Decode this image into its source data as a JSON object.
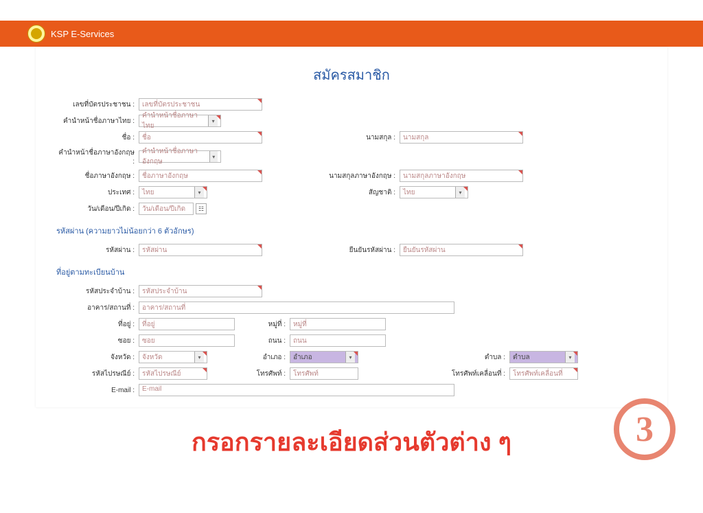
{
  "brand": "KSP E-Services",
  "page_title": "สมัครสมาชิก",
  "step_number": "3",
  "instruction_text": "กรอกรายละเอียดส่วนตัวต่าง ๆ",
  "labels": {
    "id_card": "เลขที่บัตรประชาชน :",
    "title_th": "คำนำหน้าชื่อภาษาไทย :",
    "name_th": "ชื่อ :",
    "surname_th": "นามสกุล :",
    "title_en": "คำนำหน้าชื่อภาษาอังกฤษ :",
    "name_en": "ชื่อภาษาอังกฤษ :",
    "surname_en": "นามสกุลภาษาอังกฤษ :",
    "country": "ประเทศ :",
    "nationality": "สัญชาติ :",
    "birthdate": "วัน/เดือน/ปีเกิด :",
    "password": "รหัสผ่าน :",
    "confirm_password": "ยืนยันรหัสผ่าน :",
    "house_code": "รหัสประจำบ้าน :",
    "address": "อาคาร/สถานที่ :",
    "at": "ที่อยู่ :",
    "moo": "หมู่ที่ :",
    "soi": "ซอย :",
    "road": "ถนน :",
    "province": "จังหวัด :",
    "district": "อำเภอ :",
    "subdistrict": "ตำบล :",
    "postcode": "รหัสไปรษณีย์ :",
    "phone": "โทรศัพท์ :",
    "mobile": "โทรศัพท์เคลื่อนที่ :",
    "email": "E-mail :"
  },
  "placeholders": {
    "id_card": "เลขที่บัตรประชาชน",
    "title_th": "คำนำหน้าชื่อภาษาไทย",
    "name_th": "ชื่อ",
    "surname_th": "นามสกุล",
    "title_en": "คำนำหน้าชื่อภาษาอังกฤษ",
    "name_en": "ชื่อภาษาอังกฤษ",
    "surname_en": "นามสกุลภาษาอังกฤษ",
    "country": "ไทย",
    "nationality": "ไทย",
    "birthdate": "วัน/เดือน/ปีเกิด",
    "password": "รหัสผ่าน",
    "confirm_password": "ยืนยันรหัสผ่าน",
    "house_code": "รหัสประจำบ้าน",
    "address": "อาคาร/สถานที่",
    "at": "ที่อยู่",
    "moo": "หมู่ที่",
    "soi": "ซอย",
    "road": "ถนน",
    "province": "จังหวัด",
    "district": "อำเภอ",
    "subdistrict": "ตำบล",
    "postcode": "รหัสไปรษณีย์",
    "phone": "โทรศัพท์",
    "mobile": "โทรศัพท์เคลื่อนที่",
    "email": "E-mail"
  },
  "sections": {
    "password": "รหัสผ่าน (ความยาวไม่น้อยกว่า 6 ตัวอักษร)",
    "address": "ที่อยู่ตามทะเบียนบ้าน"
  }
}
